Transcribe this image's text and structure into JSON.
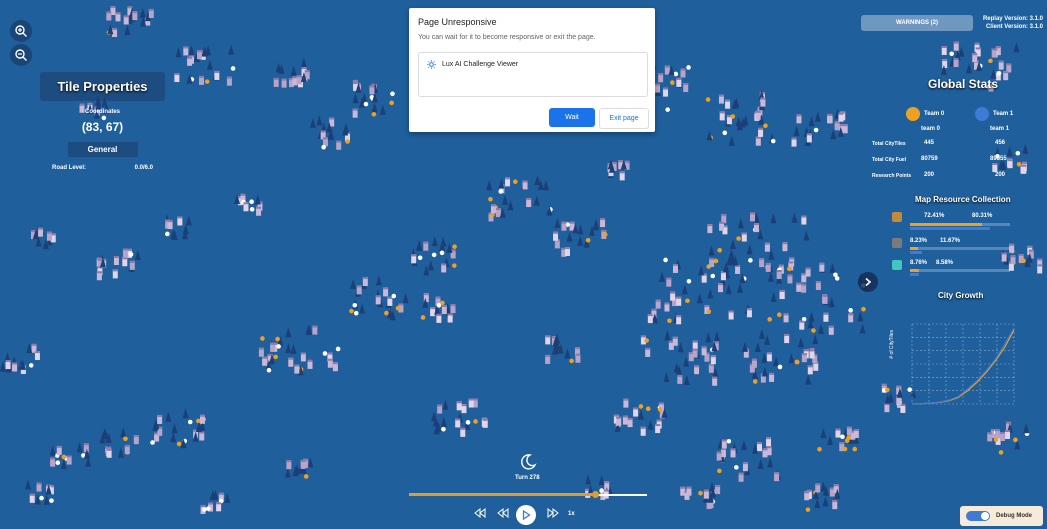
{
  "colors": {
    "ocean": "#1f5f9c",
    "team0": "#f0a020",
    "team1": "#3d7bd4",
    "accent": "#1a73e8",
    "timeline": "#e79b27"
  },
  "zoom": {
    "in_icon": "zoom-in-icon",
    "out_icon": "zoom-out-icon"
  },
  "tile": {
    "title": "Tile Properties",
    "coords_label": "Coordinates",
    "coords": "(83, 67)",
    "general_label": "General",
    "road_label": "Road Level:",
    "road_value": "0.0/6.0"
  },
  "dialog": {
    "title": "Page Unresponsive",
    "message": "You can wait for it to become responsive or exit the page.",
    "page_name": "Lux AI Challenge Viewer",
    "wait": "Wait",
    "exit": "Exit page"
  },
  "warnings": "WARNINGS (2)",
  "versions": {
    "replay": "Replay Version: 3.1.0",
    "client": "Client Version: 3.1.0"
  },
  "stats": {
    "title": "Global Stats",
    "team0_icon_label": "Team 0",
    "team1_icon_label": "Team 1",
    "team0": "team 0",
    "team1": "team 1",
    "rows": [
      {
        "label": "Total CityTiles",
        "t0": "445",
        "t1": "456"
      },
      {
        "label": "Total City Fuel",
        "t0": "80759",
        "t1": "89555"
      },
      {
        "label": "Research Points",
        "t0": "200",
        "t1": "200"
      }
    ]
  },
  "resources": {
    "title": "Map Resource Collection",
    "wood": {
      "t0": "72.41%",
      "t1": "80.31%",
      "t0_frac": 0.7241,
      "t1_frac": 0.8031
    },
    "coal": {
      "t0": "8.23%",
      "t1": "11.67%",
      "t0_frac": 0.0823,
      "t1_frac": 0.1167
    },
    "uranium": {
      "t0": "8.76%",
      "t1": "8.58%",
      "t0_frac": 0.0876,
      "t1_frac": 0.0858
    }
  },
  "city_growth": {
    "title": "City Growth",
    "ylabel": "# of CityTiles"
  },
  "chart_data": {
    "type": "line",
    "title": "City Growth",
    "ylabel": "# of CityTiles",
    "series": [
      {
        "name": "team 0",
        "values": [
          0,
          2,
          5,
          10,
          20,
          40,
          80,
          130,
          190,
          260,
          340,
          445
        ]
      },
      {
        "name": "team 1",
        "values": [
          0,
          3,
          6,
          12,
          24,
          45,
          90,
          140,
          200,
          270,
          360,
          456
        ]
      }
    ],
    "ylim": [
      0,
      480
    ],
    "grid": true
  },
  "controls": {
    "turn": "Turn 278",
    "turn_progress": 0.78,
    "speed": "1x"
  },
  "debug": {
    "label": "Debug Mode"
  }
}
